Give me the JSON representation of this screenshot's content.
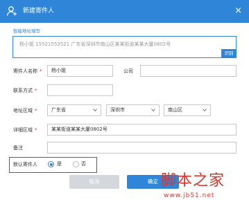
{
  "dialog": {
    "title": "新建寄件人",
    "close_glyph": "×"
  },
  "smart_fill": {
    "label": "智能地址填写",
    "text": "杨小姐 15521553521 广东省深圳市南山区某某街道某某大厦0802号",
    "recognize_label": "识别"
  },
  "form": {
    "name_label": "寄件人名称",
    "name_value": "杨小姐",
    "company_label": "公司",
    "company_value": "",
    "phone_label": "联系方式",
    "phone_value": "",
    "region_label": "地址区域",
    "province": "广东省",
    "city": "深圳市",
    "district": "南山区",
    "detail_label": "详细区域",
    "detail_value": "某某街道某某大厦0802号",
    "note_label": "备注",
    "note_value": "",
    "required_mark": "*"
  },
  "default_sender": {
    "label": "默认寄件人",
    "yes": "是",
    "no": "否",
    "selected": "yes"
  },
  "buttons": {
    "cancel": "取消",
    "ok": "确定"
  },
  "watermark": {
    "title": "脚本之家",
    "url": "www.jb51.net"
  },
  "colors": {
    "accent": "#2f86d8",
    "required": "#e2231a",
    "highlight_border": "#d42a2a",
    "cancel_bg": "#d4d7db",
    "watermark": "#d6362b"
  },
  "icons": {
    "title_icon": "add-user-icon",
    "select_arrow": "chevron-down-icon"
  }
}
